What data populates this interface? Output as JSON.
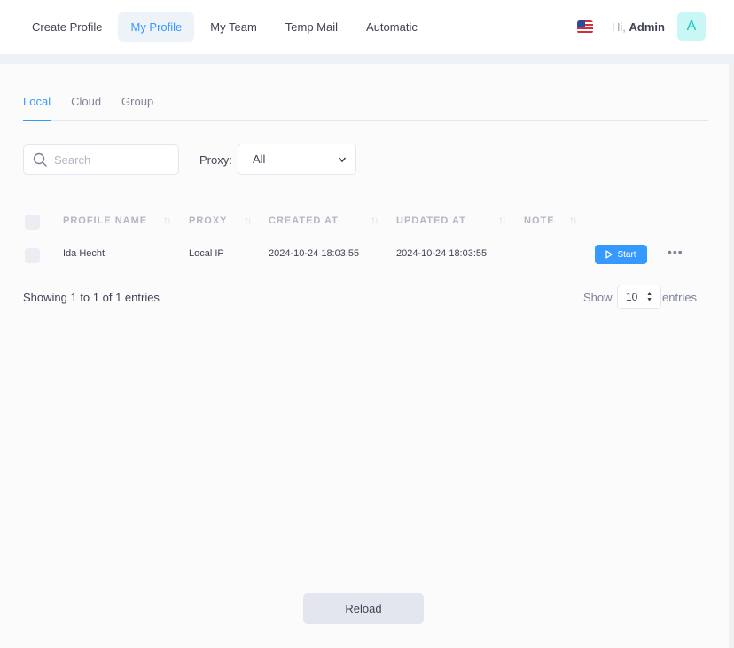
{
  "nav": {
    "items": [
      {
        "label": "Create Profile",
        "active": false
      },
      {
        "label": "My Profile",
        "active": true
      },
      {
        "label": "My Team",
        "active": false
      },
      {
        "label": "Temp Mail",
        "active": false
      },
      {
        "label": "Automatic",
        "active": false
      }
    ]
  },
  "user": {
    "greeting": "Hi,",
    "name": "Admin",
    "avatar_letter": "A",
    "flag_icon": "us-flag-icon"
  },
  "tabs": [
    {
      "label": "Local",
      "active": true
    },
    {
      "label": "Cloud",
      "active": false
    },
    {
      "label": "Group",
      "active": false
    }
  ],
  "filters": {
    "search_placeholder": "Search",
    "search_value": "",
    "proxy_label": "Proxy:",
    "proxy_selected": "All"
  },
  "table": {
    "columns": [
      "PROFILE NAME",
      "PROXY",
      "CREATED AT",
      "UPDATED AT",
      "NOTE"
    ],
    "rows": [
      {
        "profile_name": "Ida Hecht",
        "proxy": "Local IP",
        "created_at": "2024-10-24 18:03:55",
        "updated_at": "2024-10-24 18:03:55",
        "note": "",
        "action_label": "Start"
      }
    ]
  },
  "pagination": {
    "info": "Showing 1 to 1 of 1 entries",
    "show_label": "Show",
    "page_length": "10",
    "entries_label": "entries"
  },
  "reload_label": "Reload",
  "colors": {
    "accent": "#3699ff",
    "avatar_bg": "#c9f7f5",
    "avatar_fg": "#1bc5bd"
  }
}
